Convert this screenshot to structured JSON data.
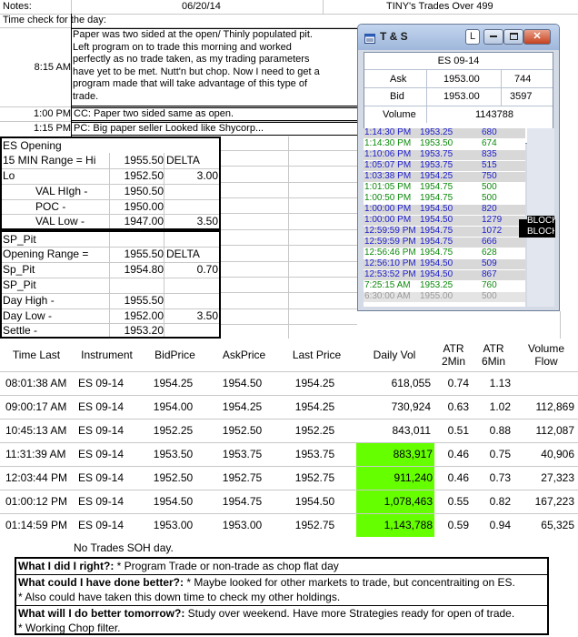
{
  "header": {
    "notes_label": "Notes:",
    "date": "06/20/14",
    "title": "TINY's Trades Over 499"
  },
  "time_check": {
    "label": "Time check for the day:",
    "entries": [
      {
        "time": "8:15 AM",
        "lines": [
          "Paper was two sided at the open/ Thinly populated pit.",
          "Left program on to trade this morning and worked",
          "perfectly as no trade taken, as my trading parameters",
          "have yet to be met.  Nutt'n but chop.  Now I need to get a",
          "program made that will take advantage of this type of",
          "trade."
        ]
      },
      {
        "time": "1:00 PM",
        "lines": [
          "CC: Paper two sided same as open."
        ]
      },
      {
        "time": "1:15 PM",
        "lines": [
          "PC: Big paper seller Looked like Shycorp..."
        ]
      }
    ]
  },
  "es_opening": {
    "title": "ES Opening",
    "rows": [
      {
        "label": "15 MIN Range = Hi",
        "value": "1955.50",
        "extra": "DELTA"
      },
      {
        "label": "Lo",
        "value": "1952.50",
        "extra": "3.00"
      },
      {
        "label": "VAL HIgh   -",
        "value": "1950.50",
        "extra": ""
      },
      {
        "label": "POC   -",
        "value": "1950.00",
        "extra": ""
      },
      {
        "label": "VAL Low   -",
        "value": "1947.00",
        "extra": "3.50"
      }
    ]
  },
  "sp_pit": {
    "rows": [
      {
        "label": "SP_Pit",
        "value": "",
        "extra": ""
      },
      {
        "label": "Opening Range =",
        "value": "1955.50",
        "extra": "DELTA"
      },
      {
        "label": "Sp_Pit",
        "value": "1954.80",
        "extra": "0.70"
      },
      {
        "label": "SP_Pit",
        "value": "",
        "extra": ""
      },
      {
        "label": "Day High -",
        "value": "1955.50",
        "extra": ""
      },
      {
        "label": "Day Low -",
        "value": "1952.00",
        "extra": "3.50"
      },
      {
        "label": "Settle -",
        "value": "1953.20",
        "extra": ""
      }
    ]
  },
  "ts_window": {
    "title": "T & S",
    "ctl_min": "L",
    "symbol": "ES 09-14",
    "ask_label": "Ask",
    "ask": "1953.00",
    "ask_size": "744",
    "bid_label": "Bid",
    "bid": "1953.00",
    "bid_size": "3597",
    "volume_label": "Volume",
    "volume": "1143788",
    "trades": [
      {
        "time": "1:14:30 PM",
        "price": "1953.25",
        "size": "680",
        "color": "#1d1dcc",
        "bg": "#d8d8d8",
        "tag": ""
      },
      {
        "time": "1:14:30 PM",
        "price": "1953.50",
        "size": "674",
        "color": "#0c8a0c",
        "bg": "#ffffff",
        "tag": ""
      },
      {
        "time": "1:10:06 PM",
        "price": "1953.75",
        "size": "835",
        "color": "#1d1dcc",
        "bg": "#d8d8d8",
        "tag": ""
      },
      {
        "time": "1:05:07 PM",
        "price": "1953.75",
        "size": "515",
        "color": "#1d1dcc",
        "bg": "#d8d8d8",
        "tag": ""
      },
      {
        "time": "1:03:38 PM",
        "price": "1954.25",
        "size": "750",
        "color": "#1d1dcc",
        "bg": "#d8d8d8",
        "tag": ""
      },
      {
        "time": "1:01:05 PM",
        "price": "1954.75",
        "size": "500",
        "color": "#0c8a0c",
        "bg": "#ffffff",
        "tag": ""
      },
      {
        "time": "1:00:50 PM",
        "price": "1954.75",
        "size": "500",
        "color": "#0c8a0c",
        "bg": "#ffffff",
        "tag": ""
      },
      {
        "time": "1:00:00 PM",
        "price": "1954.50",
        "size": "820",
        "color": "#1d1dcc",
        "bg": "#d8d8d8",
        "tag": ""
      },
      {
        "time": "1:00:00 PM",
        "price": "1954.50",
        "size": "1279",
        "color": "#1d1dcc",
        "bg": "#d8d8d8",
        "tag": "BLOCK"
      },
      {
        "time": "12:59:59 PM",
        "price": "1954.75",
        "size": "1072",
        "color": "#1d1dcc",
        "bg": "#d8d8d8",
        "tag": "BLOCK"
      },
      {
        "time": "12:59:59 PM",
        "price": "1954.75",
        "size": "666",
        "color": "#1d1dcc",
        "bg": "#d8d8d8",
        "tag": ""
      },
      {
        "time": "12:56:46 PM",
        "price": "1954.75",
        "size": "628",
        "color": "#0c8a0c",
        "bg": "#ffffff",
        "tag": ""
      },
      {
        "time": "12:56:10 PM",
        "price": "1954.50",
        "size": "509",
        "color": "#1d1dcc",
        "bg": "#d8d8d8",
        "tag": ""
      },
      {
        "time": "12:53:52 PM",
        "price": "1954.50",
        "size": "867",
        "color": "#1d1dcc",
        "bg": "#d8d8d8",
        "tag": ""
      },
      {
        "time": "7:25:15 AM",
        "price": "1953.25",
        "size": "760",
        "color": "#0c8a0c",
        "bg": "#ffffff",
        "tag": ""
      },
      {
        "time": "6:30:00 AM",
        "price": "1955.00",
        "size": "500",
        "color": "#9a9a9a",
        "bg": "#e4e4e4",
        "tag": ""
      }
    ]
  },
  "table": {
    "columns": [
      "Time Last",
      "Instrument",
      "BidPrice",
      "AskPrice",
      "Last Price",
      "Daily Vol",
      "ATR\n2Min",
      "ATR\n6Min",
      "Volume\nFlow"
    ],
    "rows": [
      [
        "08:01:38 AM",
        "ES 09-14",
        "1954.25",
        "1954.50",
        "1954.25",
        "618,055",
        "0.74",
        "1.13",
        ""
      ],
      [
        "09:00:17 AM",
        "ES 09-14",
        "1954.00",
        "1954.25",
        "1954.25",
        "730,924",
        "0.63",
        "1.02",
        "112,869"
      ],
      [
        "10:45:13 AM",
        "ES 09-14",
        "1952.25",
        "1952.50",
        "1952.25",
        "843,011",
        "0.51",
        "0.88",
        "112,087"
      ],
      [
        "11:31:39 AM",
        "ES 09-14",
        "1953.50",
        "1953.75",
        "1953.75",
        "883,917",
        "0.46",
        "0.75",
        "40,906"
      ],
      [
        "12:03:44 PM",
        "ES 09-14",
        "1952.50",
        "1952.75",
        "1952.75",
        "911,240",
        "0.46",
        "0.73",
        "27,323"
      ],
      [
        "01:00:12 PM",
        "ES 09-14",
        "1954.50",
        "1954.75",
        "1954.50",
        "1,078,463",
        "0.55",
        "0.82",
        "167,223"
      ],
      [
        "01:14:59 PM",
        "ES 09-14",
        "1953.00",
        "1953.00",
        "1952.75",
        "1,143,788",
        "0.59",
        "0.94",
        "65,325"
      ]
    ],
    "highlight_rows": [
      3,
      4,
      5,
      6
    ],
    "highlight_color": "#66ff00"
  },
  "no_trades": "No Trades SOH day.",
  "review": {
    "q1": "What I did I right?:",
    "a1": " * Program Trade or non-trade as chop flat day",
    "q2": "What could I have done better?:",
    "a2": " * Maybe looked for other markets to trade, but concentraiting on ES.",
    "a2b": "* Also could have taken this down time to check my other holdings.",
    "q3": "What will I do better tomorrow?:",
    "a3": "  Study over weekend.  Have more Strategies ready for open of trade.",
    "a3b": "* Working Chop filter."
  }
}
